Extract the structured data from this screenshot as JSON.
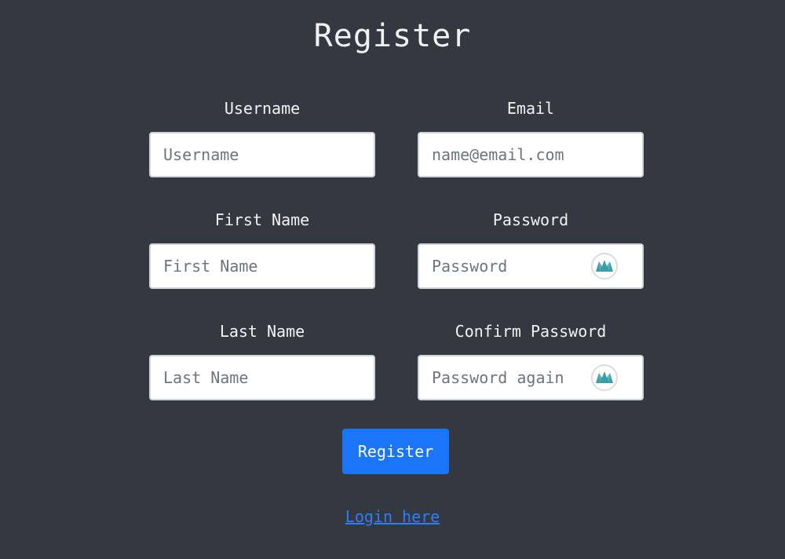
{
  "page": {
    "title": "Register"
  },
  "form": {
    "username": {
      "label": "Username",
      "placeholder": "Username",
      "value": ""
    },
    "email": {
      "label": "Email",
      "placeholder": "name@email.com",
      "value": ""
    },
    "first_name": {
      "label": "First Name",
      "placeholder": "First Name",
      "value": ""
    },
    "password": {
      "label": "Password",
      "placeholder": "Password",
      "value": "",
      "manager_icon": "password-manager-icon"
    },
    "last_name": {
      "label": "Last Name",
      "placeholder": "Last Name",
      "value": ""
    },
    "confirm_password": {
      "label": "Confirm Password",
      "placeholder": "Password again",
      "value": "",
      "manager_icon": "password-manager-icon"
    },
    "submit_label": "Register"
  },
  "footer": {
    "login_link": "Login here"
  },
  "colors": {
    "background": "#343840",
    "primary_button": "#1a75f8",
    "link": "#2f7df7",
    "input_border": "#cfd4da",
    "manager_icon": "#3d9da7"
  }
}
